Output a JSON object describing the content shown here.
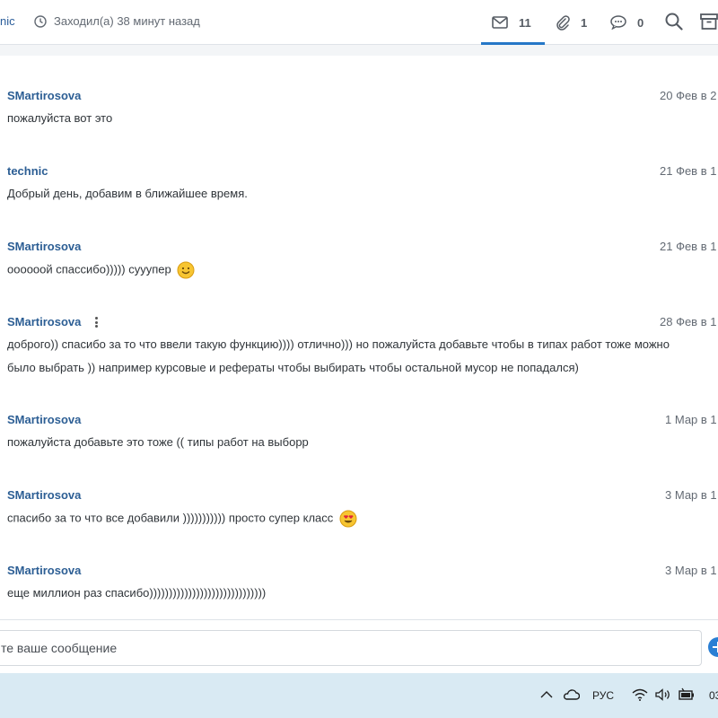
{
  "header": {
    "user_fragment": "nic",
    "last_seen": "Заходил(а) 38 минут назад",
    "tabs": [
      {
        "icon": "mail-icon",
        "count": "11"
      },
      {
        "icon": "paperclip-icon",
        "count": "1"
      },
      {
        "icon": "sms-icon",
        "count": "0"
      }
    ],
    "accent_color": "#2577c7"
  },
  "messages": [
    {
      "author": "SMartirosova",
      "date": "20 Фев в 2",
      "text": "пожалуйста вот это"
    },
    {
      "author": "technic",
      "date": "21 Фев в 1",
      "text": "Добрый день, добавим в ближайшее время."
    },
    {
      "author": "SMartirosova",
      "date": "21 Фев в 1",
      "text": "оооооой спассибо))))) сууупер",
      "emoji": "smile-emoji"
    },
    {
      "author": "SMartirosova",
      "date": "28 Фев в 1",
      "text": "доброго)) спасибо за то что ввели такую функцию)))) отлично))) но пожалуйста добавьте чтобы в типах работ тоже можно",
      "text2": "было выбрать )) например курсовые и рефераты чтобы выбирать чтобы остальной мусор не попадался)"
    },
    {
      "author": "SMartirosova",
      "date": "1 Мар в 1",
      "text": "пожалуйста добавьте это тоже (( типы работ на выборр"
    },
    {
      "author": "SMartirosova",
      "date": "3 Мар в 1",
      "text": "спасибо за то что все добавили ))))))))))) просто супер класс",
      "emoji": "heart-eyes-emoji"
    },
    {
      "author": "SMartirosova",
      "date": "3 Мар в 1",
      "text": "еще миллион раз спасибо))))))))))))))))))))))))))))))"
    }
  ],
  "composer": {
    "placeholder": "те ваше сообщение"
  },
  "taskbar": {
    "language": "РУС",
    "clock_fragment": "03"
  }
}
